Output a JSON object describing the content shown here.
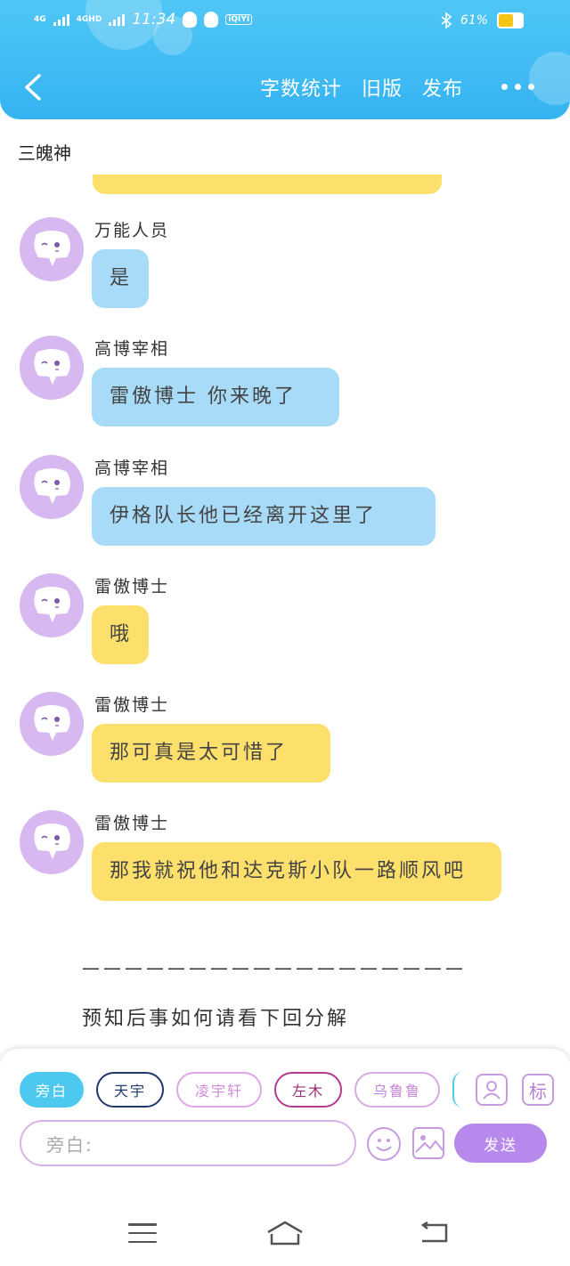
{
  "status_bar": {
    "net1": "4G",
    "net2": "4GHD",
    "time": "11:34",
    "iqiyi_label": "iQIYI",
    "battery_text": "61%",
    "battery_level": 0.61
  },
  "nav": {
    "actions": [
      "字数统计",
      "旧版",
      "发布"
    ]
  },
  "chapter_title": "三魄神",
  "messages": [
    {
      "sender": "万能人员",
      "text": "是",
      "color": "blue"
    },
    {
      "sender": "高博宰相",
      "text": "雷傲博士 你来晚了",
      "color": "blue"
    },
    {
      "sender": "高博宰相",
      "text": "伊格队长他已经离开这里了",
      "color": "blue"
    },
    {
      "sender": "雷傲博士",
      "text": "哦",
      "color": "yellow"
    },
    {
      "sender": "雷傲博士",
      "text": "那可真是太可惜了",
      "color": "yellow"
    },
    {
      "sender": "雷傲博士",
      "text": "那我就祝他和达克斯小队一路顺风吧",
      "color": "yellow"
    }
  ],
  "divider": "——————————————————",
  "ending": "预知后事如何请看下回分解",
  "roles": [
    "旁白",
    "天宇",
    "凌宇轩",
    "左木",
    "乌鲁鲁"
  ],
  "mark_label": "标",
  "input": {
    "placeholder": "旁白:"
  },
  "send_label": "发送",
  "colors": {
    "header": "#35b3f2",
    "bubble_blue": "#a8dbf8",
    "bubble_yellow": "#fddf6c",
    "avatar": "#d7b8f0",
    "send": "#b889ec"
  }
}
